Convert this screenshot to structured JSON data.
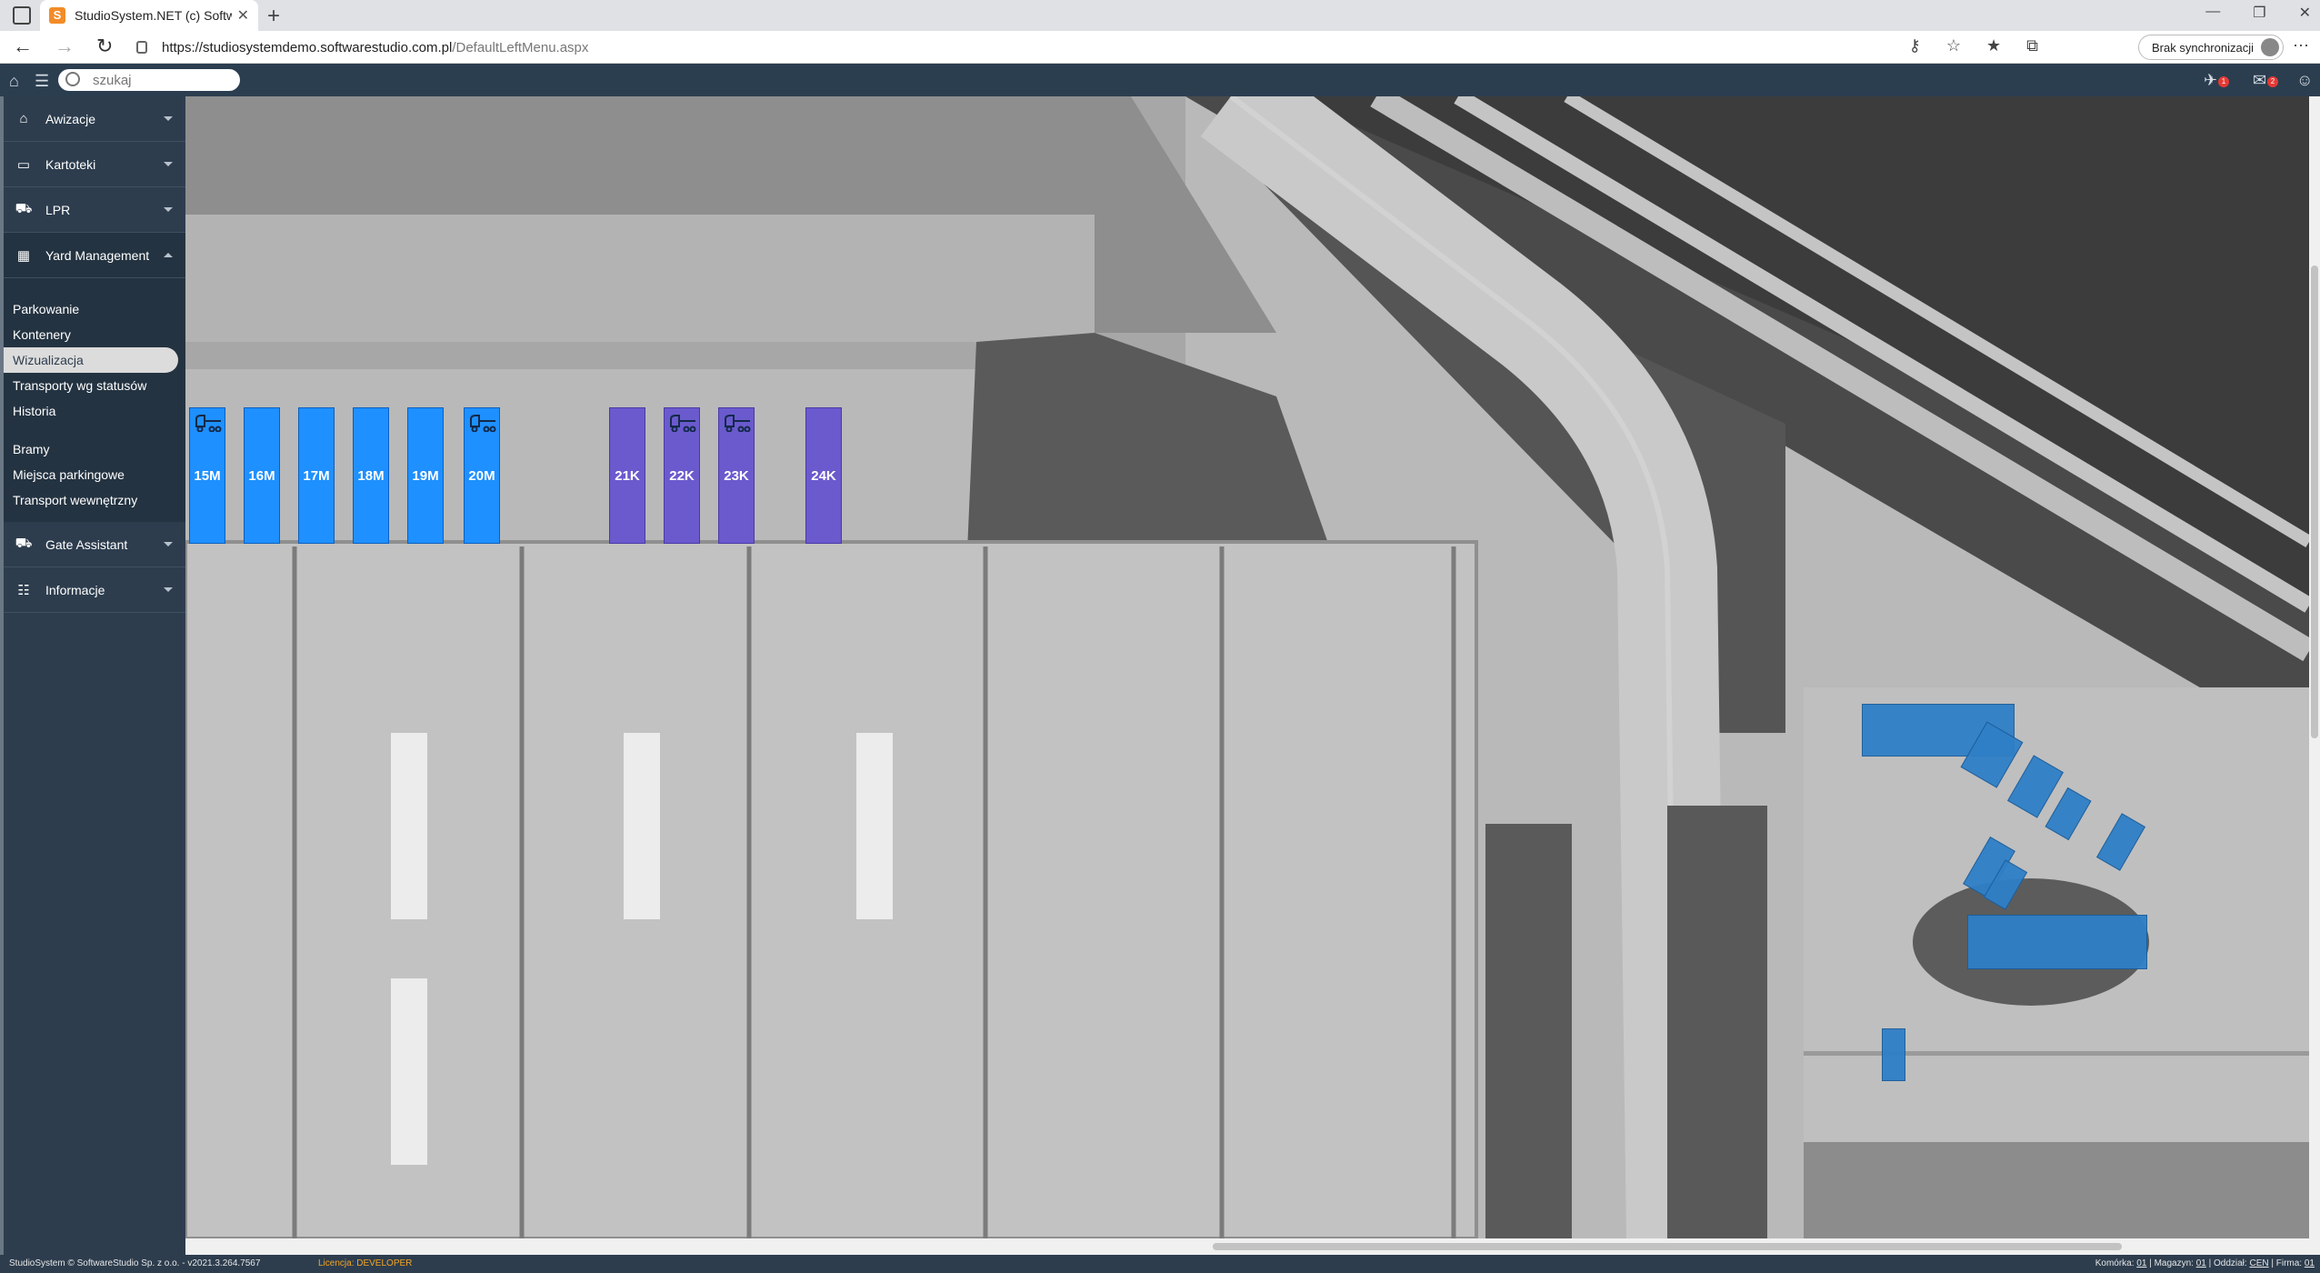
{
  "browser": {
    "tab_title": "StudioSystem.NET (c) SoftwareStudio",
    "url_host": "https://studiosystemdemo.softwarestudio.com.pl",
    "url_path": "/DefaultLeftMenu.aspx",
    "sync_label": "Brak synchronizacji"
  },
  "toolbar": {
    "search_placeholder": "szukaj",
    "notif_badge_1": "1",
    "notif_badge_2": "2"
  },
  "sidebar": {
    "sections": [
      {
        "label": "Awizacje",
        "icon": "home-icon"
      },
      {
        "label": "Kartoteki",
        "icon": "folder-icon"
      },
      {
        "label": "LPR",
        "icon": "truck-icon"
      },
      {
        "label": "Yard Management",
        "icon": "yard-icon"
      }
    ],
    "yard_items": [
      {
        "label": "Parkowanie"
      },
      {
        "label": "Kontenery"
      },
      {
        "label": "Wizualizacja",
        "active": true
      },
      {
        "label": "Transporty wg statusów"
      },
      {
        "label": "Historia"
      },
      {
        "label": "Bramy"
      },
      {
        "label": "Miejsca parkingowe"
      },
      {
        "label": "Transport wewnętrzny"
      }
    ],
    "sections_after": [
      {
        "label": "Gate Assistant",
        "icon": "gate-icon"
      },
      {
        "label": "Informacje",
        "icon": "sitemap-icon"
      }
    ]
  },
  "map": {
    "slots": [
      {
        "label": "15M",
        "kind": "m",
        "truck": true
      },
      {
        "label": "16M",
        "kind": "m",
        "truck": false
      },
      {
        "label": "17M",
        "kind": "m",
        "truck": false
      },
      {
        "label": "18M",
        "kind": "m",
        "truck": false
      },
      {
        "label": "19M",
        "kind": "m",
        "truck": false
      },
      {
        "label": "20M",
        "kind": "m",
        "truck": true
      },
      {
        "label": "21K",
        "kind": "k",
        "truck": false
      },
      {
        "label": "22K",
        "kind": "k",
        "truck": true
      },
      {
        "label": "23K",
        "kind": "k",
        "truck": true
      },
      {
        "label": "24K",
        "kind": "k",
        "truck": false
      }
    ],
    "colors": {
      "m_slot": "#1e90ff",
      "k_slot": "#6a5acd",
      "parking_slot": "#2f7fc7"
    }
  },
  "status": {
    "copyright": "StudioSystem © SoftwareStudio Sp. z o.o. - v2021.3.264.7567",
    "license": "Licencja: DEVELOPER",
    "komorka_label": "Komórka:",
    "komorka_value": "01",
    "magazyn_label": "Magazyn:",
    "magazyn_value": "01",
    "oddzial_label": "Oddział:",
    "oddzial_value": "CEN",
    "firma_label": "Firma:",
    "firma_value": "01"
  }
}
